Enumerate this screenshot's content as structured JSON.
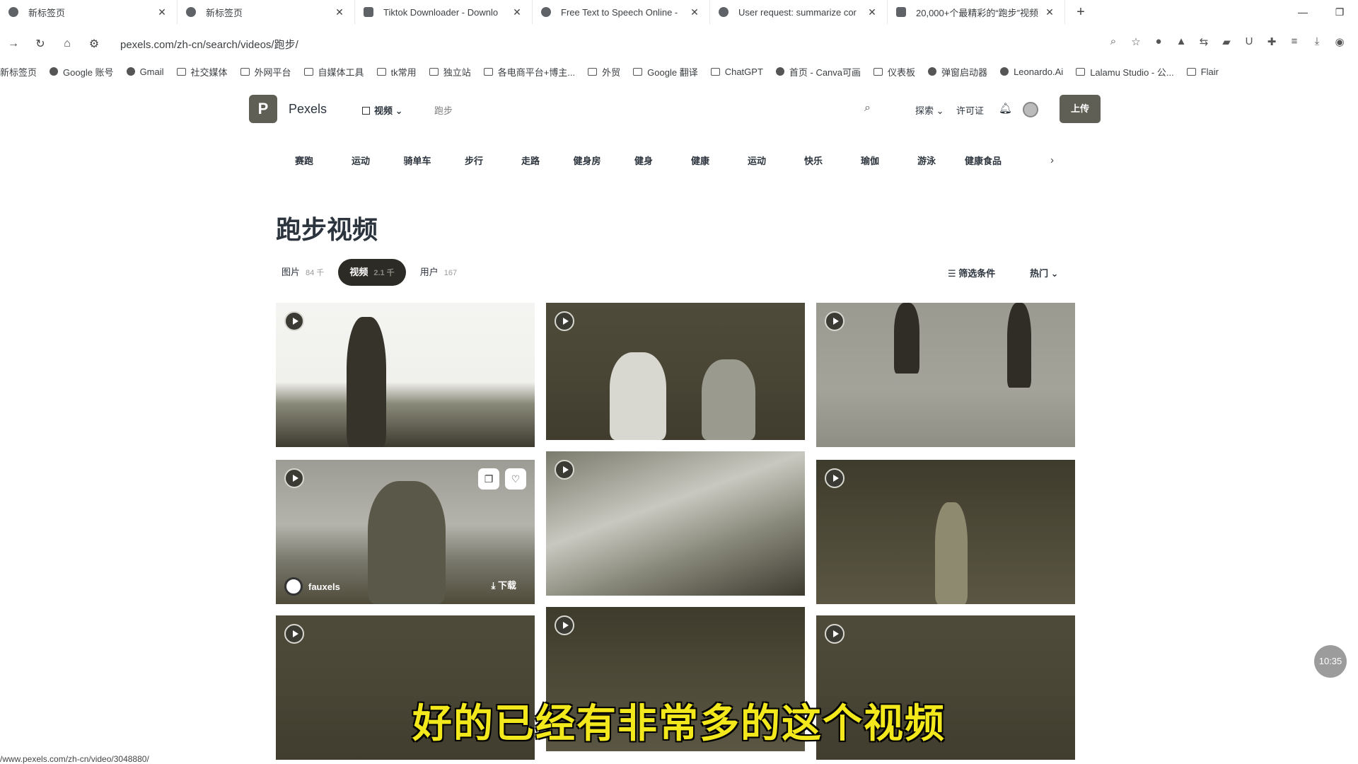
{
  "browser": {
    "tabs": [
      {
        "title": "新标签页"
      },
      {
        "title": "新标签页"
      },
      {
        "title": "Tiktok Downloader - Downlo"
      },
      {
        "title": "Free Text to Speech Online -"
      },
      {
        "title": "User request: summarize cor"
      },
      {
        "title": "20,000+个最精彩的“跑步”视频"
      }
    ],
    "new_tab": "+",
    "close_glyph": "✕",
    "url": "pexels.com/zh-cn/search/videos/跑步/",
    "bookmarks": [
      "新标签页",
      "Google 账号",
      "Gmail",
      "社交媒体",
      "外网平台",
      "自媒体工具",
      "tk常用",
      "独立站",
      "各电商平台+博主...",
      "外贸",
      "Google 翻译",
      "ChatGPT",
      "首页 - Canva可画",
      "仪表板",
      "弹窗启动器",
      "Leonardo.Ai",
      "Lalamu Studio - 公...",
      "Flair"
    ]
  },
  "header": {
    "logo_letter": "P",
    "brand": "Pexels",
    "media_type": "视频",
    "query": "跑步",
    "explore": "探索",
    "license": "许可证",
    "upload": "上传"
  },
  "categories": [
    "赛跑",
    "运动",
    "骑单车",
    "步行",
    "走路",
    "健身房",
    "健身",
    "健康",
    "运动",
    "快乐",
    "瑜伽",
    "游泳",
    "健康食品"
  ],
  "page": {
    "title": "跑步视频",
    "tabs": [
      {
        "label": "图片",
        "count": "84 千"
      },
      {
        "label": "视频",
        "count": "2.1 千"
      },
      {
        "label": "用户",
        "count": "167"
      }
    ],
    "filter": "筛选条件",
    "sort": "热门"
  },
  "videos": [
    {
      "author": "fauxels",
      "download": "下载"
    }
  ],
  "overlay": {
    "subtitle": "好的已经有非常多的这个视频",
    "status_url": "/www.pexels.com/zh-cn/video/3048880/",
    "clock": "10:35"
  }
}
